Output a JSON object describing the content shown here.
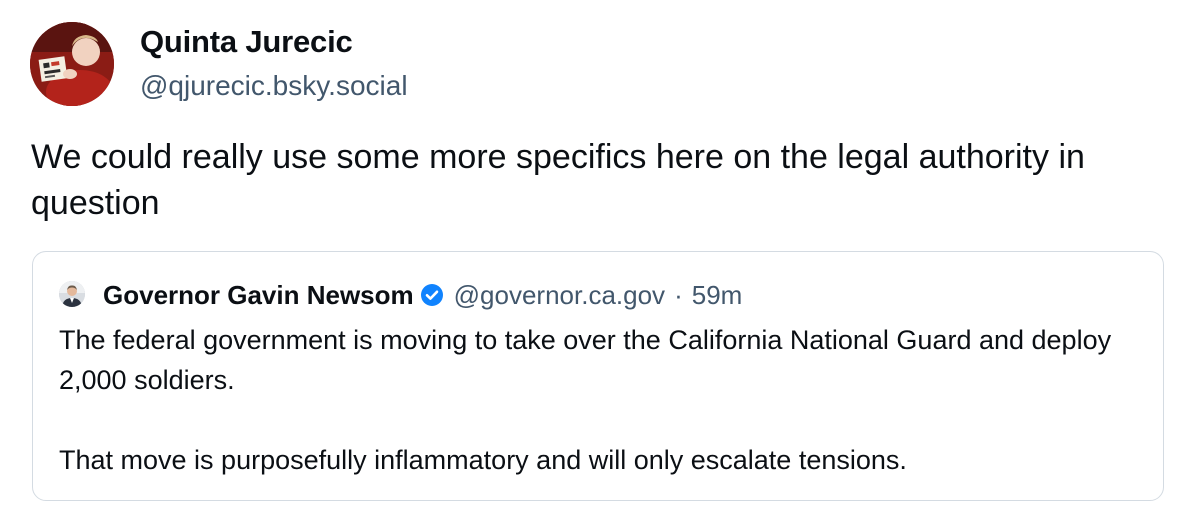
{
  "post": {
    "author": {
      "display_name": "Quinta Jurecic",
      "handle": "@qjurecic.bsky.social",
      "avatar_icon": "child-reading-avatar"
    },
    "text": "We could really use some more specifics here on the legal authority in question",
    "quote": {
      "author": {
        "display_name": "Governor Gavin Newsom",
        "verified": true,
        "handle": "@governor.ca.gov",
        "avatar_icon": "portrait-avatar"
      },
      "separator": "·",
      "time": "59m",
      "paragraphs": [
        "The federal government is moving to take over the California National Guard and deploy 2,000 soldiers.",
        "That move is purposefully inflammatory and will only escalate tensions."
      ]
    }
  },
  "colors": {
    "text": "#0b0f14",
    "muted": "#42576c",
    "border": "#d4dbe2",
    "verified_badge": "#1083fe"
  }
}
